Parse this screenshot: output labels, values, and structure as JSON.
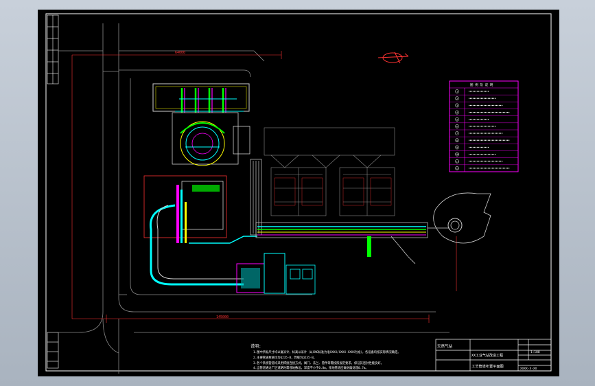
{
  "drawing": {
    "notes_title": "说明:",
    "notes": [
      "1.图中所标尺寸均以毫米计，标高以米计（以CNG标准为准XXXX/XXXX-XXXX为准），各设备均按实际情况确定。",
      "2.主要管道材质均为Q235-B，焊缝为Q235-B。",
      "3.各个系统管道均采用焊接连接方式，阀门、法兰、管件等需按照规范要求，保证其密封性能良好。",
      "4.当管道通过厂区道路时需埋地敷设，深度不小于0.8m，埋地管道应做防腐处理0.7m。"
    ],
    "legend_title": "图 例 及 说 明",
    "legend_rows": [
      "1",
      "2",
      "3",
      "4",
      "5",
      "6",
      "7",
      "8",
      "9",
      "10",
      "11",
      "12"
    ],
    "title_block": {
      "project": "天然气站",
      "drawing_title": "工艺管道布置平面图",
      "name_cell": "XX工业气站改造工程",
      "drawing_no": "XXXX-X-XX",
      "scale": "1:100"
    },
    "colors": {
      "frame": "#ffffff",
      "pipe_cyan": "#00ffff",
      "pipe_green": "#00ff00",
      "pipe_magenta": "#ff00ff",
      "pipe_yellow": "#ffff00",
      "dim_red": "#ff3333",
      "building_white": "#d0d0d0",
      "grey": "#8a8a8a"
    }
  }
}
